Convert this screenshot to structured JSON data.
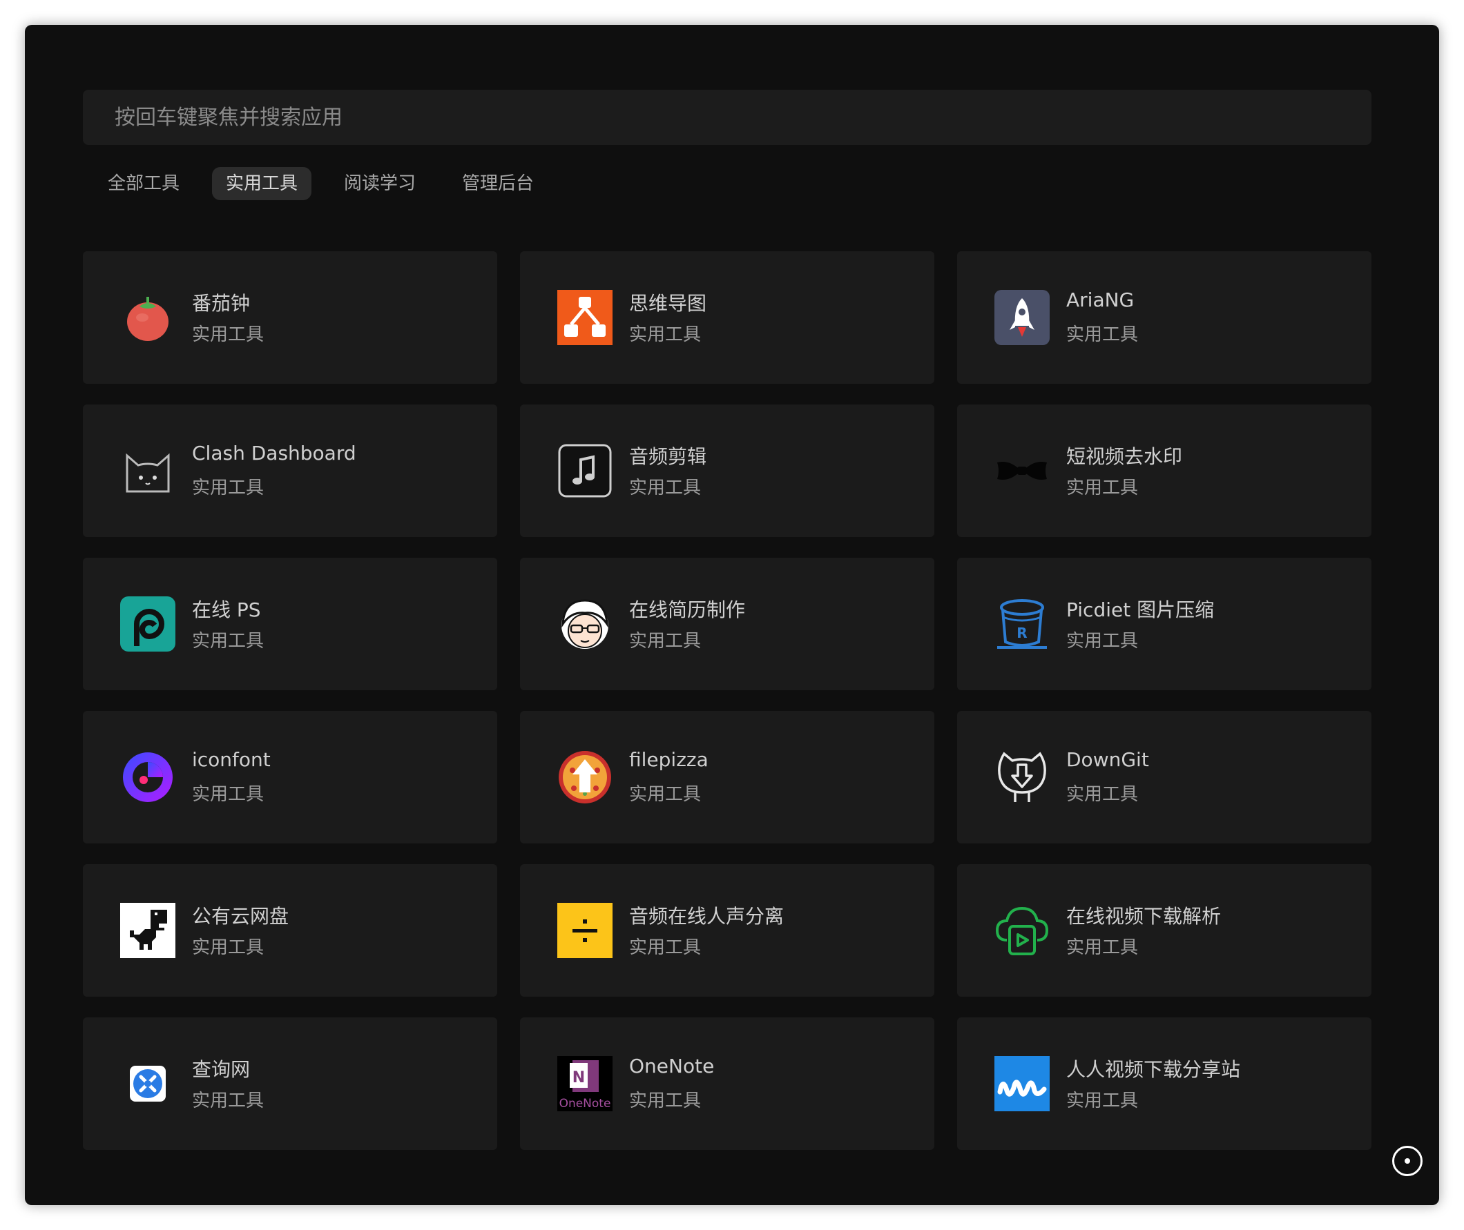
{
  "search": {
    "placeholder": "按回车键聚焦并搜索应用"
  },
  "tabs": [
    {
      "label": "全部工具",
      "active": false
    },
    {
      "label": "实用工具",
      "active": true
    },
    {
      "label": "阅读学习",
      "active": false
    },
    {
      "label": "管理后台",
      "active": false
    }
  ],
  "cards": [
    {
      "title": "番茄钟",
      "category": "实用工具",
      "icon": "tomato-icon"
    },
    {
      "title": "思维导图",
      "category": "实用工具",
      "icon": "mindmap-icon"
    },
    {
      "title": "AriaNG",
      "category": "实用工具",
      "icon": "rocket-icon"
    },
    {
      "title": "Clash Dashboard",
      "category": "实用工具",
      "icon": "cat-icon"
    },
    {
      "title": "音频剪辑",
      "category": "实用工具",
      "icon": "music-note-icon"
    },
    {
      "title": "短视频去水印",
      "category": "实用工具",
      "icon": "bowtie-icon"
    },
    {
      "title": "在线 PS",
      "category": "实用工具",
      "icon": "photopea-icon"
    },
    {
      "title": "在线简历制作",
      "category": "实用工具",
      "icon": "avatar-face-icon"
    },
    {
      "title": "Picdiet 图片压缩",
      "category": "实用工具",
      "icon": "bucket-icon"
    },
    {
      "title": "iconfont",
      "category": "实用工具",
      "icon": "iconfont-icon"
    },
    {
      "title": "filepizza",
      "category": "实用工具",
      "icon": "pizza-icon"
    },
    {
      "title": "DownGit",
      "category": "实用工具",
      "icon": "github-download-icon"
    },
    {
      "title": "公有云网盘",
      "category": "实用工具",
      "icon": "dino-icon"
    },
    {
      "title": "音频在线人声分离",
      "category": "实用工具",
      "icon": "divide-icon"
    },
    {
      "title": "在线视频下载解析",
      "category": "实用工具",
      "icon": "cloud-video-icon"
    },
    {
      "title": "查询网",
      "category": "实用工具",
      "icon": "tools-icon"
    },
    {
      "title": "OneNote",
      "category": "实用工具",
      "icon": "onenote-icon"
    },
    {
      "title": "人人视频下载分享站",
      "category": "实用工具",
      "icon": "wave-logo-icon"
    }
  ],
  "colors": {
    "background": "#0f0f0f",
    "card": "#1b1b1b",
    "tab_active": "#2c2c2c"
  }
}
